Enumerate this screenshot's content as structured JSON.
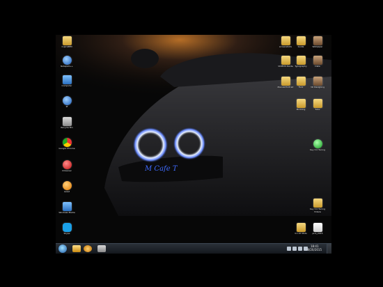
{
  "desktop": {
    "left_icons": [
      {
        "label": "CuprisBIM",
        "icon": "folder-icon"
      },
      {
        "label": "Notepad++",
        "icon": "settings-app-icon"
      },
      {
        "label": "Computer",
        "icon": "computer-icon"
      },
      {
        "label": "IE",
        "icon": "ie-icon"
      },
      {
        "label": "Recycle Bin",
        "icon": "recycle-bin-icon"
      },
      {
        "label": "Google Chrome",
        "icon": "chrome-icon"
      },
      {
        "label": "CCleaner",
        "icon": "ccleaner-icon"
      },
      {
        "label": "Avast",
        "icon": "avast-icon"
      },
      {
        "label": "Windows Media",
        "icon": "media-icon"
      },
      {
        "label": "Skype",
        "icon": "skype-icon"
      },
      {
        "label": "Kaspersky",
        "icon": "security-icon"
      }
    ],
    "right_icons": [
      {
        "label": "screenshots",
        "icon": "folder-icon"
      },
      {
        "label": "Guide",
        "icon": "folder-icon"
      },
      {
        "label": "Wallpaper",
        "icon": "photo-icon"
      },
      {
        "label": "VIDEOS Dante",
        "icon": "folder-icon"
      },
      {
        "label": "Typography",
        "icon": "folder-icon"
      },
      {
        "label": "Data",
        "icon": "photo-icon"
      },
      {
        "label": "Manual Portrait",
        "icon": "folder-icon"
      },
      {
        "label": "Fuzz",
        "icon": "folder-icon"
      },
      {
        "label": "3D Designing",
        "icon": "photo-icon"
      },
      {
        "label": "Modding",
        "icon": "folder-icon"
      },
      {
        "label": "Tutor",
        "icon": "folder-icon"
      },
      {
        "label": "Key 3.0 Tuning",
        "icon": "green-app-icon"
      },
      {
        "label": "Key 3.0 Tuning Videos",
        "icon": "folder-icon"
      },
      {
        "label": "pics_2015",
        "icon": "image-icon"
      },
      {
        "label": "3.1.07 Moto",
        "icon": "folder-icon"
      },
      {
        "label": "AutoPlus",
        "icon": "app-icon"
      }
    ]
  },
  "taskbar": {
    "clock_time": "18:41",
    "clock_date": "8/20/2015"
  },
  "wallpaper": {
    "signature": "M Cafe T"
  }
}
